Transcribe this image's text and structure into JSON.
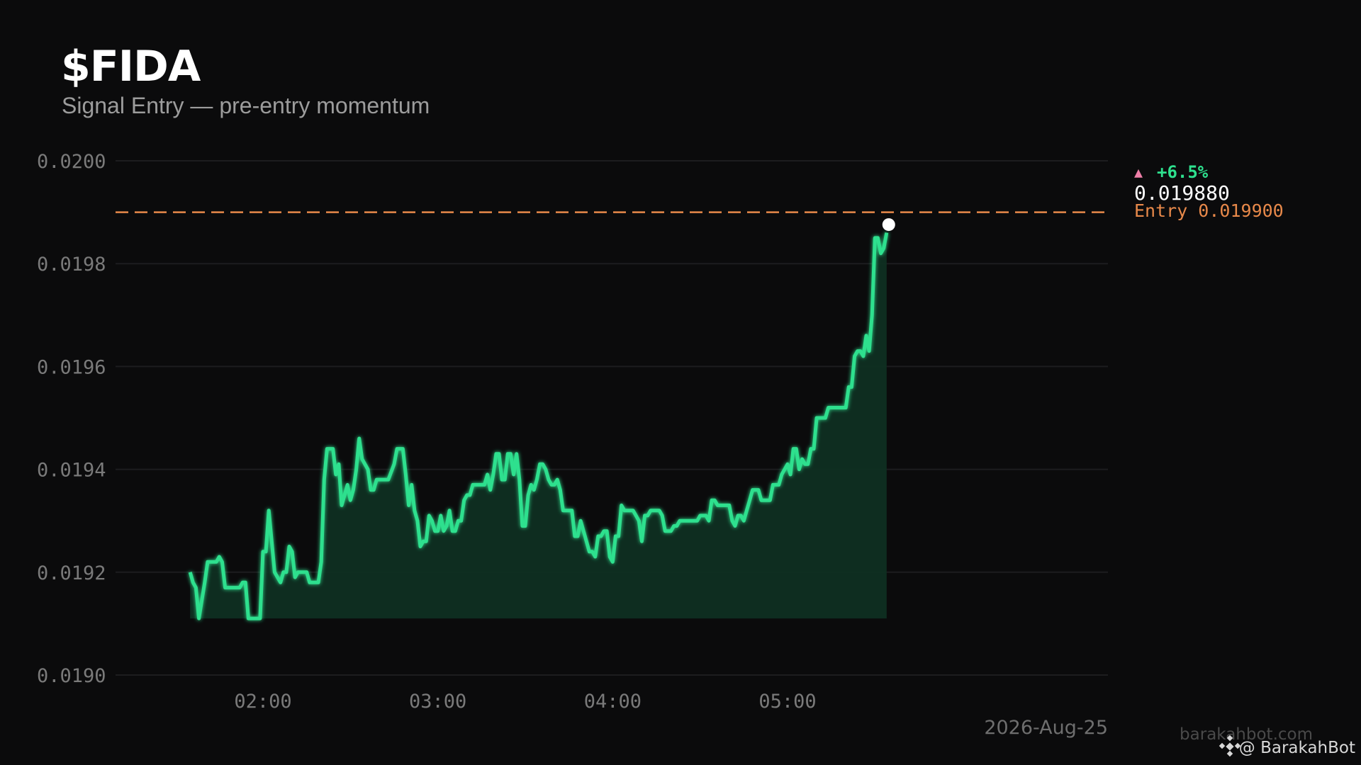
{
  "header": {
    "title": "$FIDA",
    "subtitle": "Signal Entry — pre-entry momentum"
  },
  "colors": {
    "background": "#0b0b0c",
    "line": "#2ee08e",
    "fill": "#0f2f22",
    "entry": "#e8894a",
    "change_up": "#ef7fa8",
    "change_pct": "#2ee08e",
    "axis_text": "#7a7a7a",
    "grid": "#1d1d1f"
  },
  "chart_data": {
    "type": "area",
    "title": "$FIDA",
    "subtitle": "Signal Entry — pre-entry momentum",
    "date_label": "2026-Aug-25",
    "x_range": [
      "01:35",
      "05:35"
    ],
    "ylim": [
      0.019,
      0.0201
    ],
    "y_ticks": [
      "0.0190",
      "0.0192",
      "0.0194",
      "0.0196",
      "0.0198",
      "0.0200"
    ],
    "x_ticks": [
      {
        "time": "02:00",
        "label": "02:00"
      },
      {
        "time": "03:00",
        "label": "03:00"
      },
      {
        "time": "04:00",
        "label": "04:00"
      },
      {
        "time": "05:00",
        "label": "05:00"
      }
    ],
    "grid": true,
    "entry_price": 0.0199,
    "entry_label": "Entry 0.019900",
    "last_price": 0.01988,
    "last_price_label": "0.019880",
    "change_arrow": "▲",
    "change_label": "+6.5%",
    "series": [
      {
        "name": "",
        "points": [
          [
            "01:35",
            0.0192
          ],
          [
            "01:36",
            0.01918
          ],
          [
            "01:37",
            0.01917
          ],
          [
            "01:38",
            0.01911
          ],
          [
            "01:40",
            0.01918
          ],
          [
            "01:41",
            0.01922
          ],
          [
            "01:43",
            0.01922
          ],
          [
            "01:44",
            0.01922
          ],
          [
            "01:45",
            0.01923
          ],
          [
            "01:46",
            0.01922
          ],
          [
            "01:47",
            0.01917
          ],
          [
            "01:49",
            0.01917
          ],
          [
            "01:51",
            0.01917
          ],
          [
            "01:52",
            0.01917
          ],
          [
            "01:53",
            0.01918
          ],
          [
            "01:54",
            0.01918
          ],
          [
            "01:55",
            0.01911
          ],
          [
            "01:57",
            0.01911
          ],
          [
            "01:59",
            0.01911
          ],
          [
            "02:00",
            0.01924
          ],
          [
            "02:01",
            0.01924
          ],
          [
            "02:02",
            0.01932
          ],
          [
            "02:04",
            0.0192
          ],
          [
            "02:06",
            0.01918
          ],
          [
            "02:07",
            0.0192
          ],
          [
            "02:08",
            0.0192
          ],
          [
            "02:09",
            0.01925
          ],
          [
            "02:10",
            0.01924
          ],
          [
            "02:11",
            0.01919
          ],
          [
            "02:12",
            0.0192
          ],
          [
            "02:14",
            0.0192
          ],
          [
            "02:15",
            0.0192
          ],
          [
            "02:16",
            0.01918
          ],
          [
            "02:18",
            0.01918
          ],
          [
            "02:19",
            0.01918
          ],
          [
            "02:20",
            0.01922
          ],
          [
            "02:21",
            0.01938
          ],
          [
            "02:22",
            0.01944
          ],
          [
            "02:24",
            0.01944
          ],
          [
            "02:25",
            0.01939
          ],
          [
            "02:26",
            0.01941
          ],
          [
            "02:27",
            0.01933
          ],
          [
            "02:28",
            0.01935
          ],
          [
            "02:29",
            0.01937
          ],
          [
            "02:30",
            0.01934
          ],
          [
            "02:31",
            0.01936
          ],
          [
            "02:32",
            0.0194
          ],
          [
            "02:33",
            0.01946
          ],
          [
            "02:34",
            0.01942
          ],
          [
            "02:36",
            0.0194
          ],
          [
            "02:37",
            0.01936
          ],
          [
            "02:38",
            0.01936
          ],
          [
            "02:39",
            0.01938
          ],
          [
            "02:41",
            0.01938
          ],
          [
            "02:42",
            0.01938
          ],
          [
            "02:43",
            0.01938
          ],
          [
            "02:45",
            0.01941
          ],
          [
            "02:46",
            0.01944
          ],
          [
            "02:48",
            0.01944
          ],
          [
            "02:49",
            0.01939
          ],
          [
            "02:50",
            0.01933
          ],
          [
            "02:51",
            0.01937
          ],
          [
            "02:52",
            0.01932
          ],
          [
            "02:53",
            0.0193
          ],
          [
            "02:54",
            0.01925
          ],
          [
            "02:55",
            0.01926
          ],
          [
            "02:56",
            0.01926
          ],
          [
            "02:57",
            0.01931
          ],
          [
            "02:58",
            0.0193
          ],
          [
            "02:59",
            0.01928
          ],
          [
            "03:00",
            0.01928
          ],
          [
            "03:01",
            0.01931
          ],
          [
            "03:02",
            0.01928
          ],
          [
            "03:03",
            0.01929
          ],
          [
            "03:04",
            0.01932
          ],
          [
            "03:05",
            0.01928
          ],
          [
            "03:06",
            0.01928
          ],
          [
            "03:07",
            0.0193
          ],
          [
            "03:08",
            0.0193
          ],
          [
            "03:09",
            0.01934
          ],
          [
            "03:10",
            0.01935
          ],
          [
            "03:11",
            0.01935
          ],
          [
            "03:12",
            0.01937
          ],
          [
            "03:14",
            0.01937
          ],
          [
            "03:15",
            0.01937
          ],
          [
            "03:16",
            0.01937
          ],
          [
            "03:17",
            0.01939
          ],
          [
            "03:18",
            0.01936
          ],
          [
            "03:19",
            0.01939
          ],
          [
            "03:20",
            0.01943
          ],
          [
            "03:21",
            0.01943
          ],
          [
            "03:22",
            0.01938
          ],
          [
            "03:23",
            0.01938
          ],
          [
            "03:24",
            0.01943
          ],
          [
            "03:25",
            0.01943
          ],
          [
            "03:26",
            0.01939
          ],
          [
            "03:27",
            0.01943
          ],
          [
            "03:28",
            0.01938
          ],
          [
            "03:29",
            0.01929
          ],
          [
            "03:30",
            0.01929
          ],
          [
            "03:31",
            0.01935
          ],
          [
            "03:32",
            0.01937
          ],
          [
            "03:33",
            0.01936
          ],
          [
            "03:34",
            0.01938
          ],
          [
            "03:35",
            0.01941
          ],
          [
            "03:36",
            0.01941
          ],
          [
            "03:37",
            0.0194
          ],
          [
            "03:38",
            0.01938
          ],
          [
            "03:39",
            0.01937
          ],
          [
            "03:40",
            0.01937
          ],
          [
            "03:41",
            0.01938
          ],
          [
            "03:42",
            0.01936
          ],
          [
            "03:43",
            0.01932
          ],
          [
            "03:44",
            0.01932
          ],
          [
            "03:45",
            0.01932
          ],
          [
            "03:46",
            0.01932
          ],
          [
            "03:47",
            0.01927
          ],
          [
            "03:48",
            0.01927
          ],
          [
            "03:49",
            0.0193
          ],
          [
            "03:50",
            0.01928
          ],
          [
            "03:51",
            0.01926
          ],
          [
            "03:52",
            0.01924
          ],
          [
            "03:53",
            0.01924
          ],
          [
            "03:54",
            0.01923
          ],
          [
            "03:55",
            0.01927
          ],
          [
            "03:56",
            0.01927
          ],
          [
            "03:57",
            0.01928
          ],
          [
            "03:58",
            0.01928
          ],
          [
            "03:59",
            0.01923
          ],
          [
            "04:00",
            0.01922
          ],
          [
            "04:01",
            0.01927
          ],
          [
            "04:02",
            0.01927
          ],
          [
            "04:03",
            0.01933
          ],
          [
            "04:04",
            0.01932
          ],
          [
            "04:05",
            0.01932
          ],
          [
            "04:06",
            0.01932
          ],
          [
            "04:07",
            0.01932
          ],
          [
            "04:08",
            0.01931
          ],
          [
            "04:09",
            0.0193
          ],
          [
            "04:10",
            0.01926
          ],
          [
            "04:11",
            0.01931
          ],
          [
            "04:12",
            0.01931
          ],
          [
            "04:13",
            0.01932
          ],
          [
            "04:14",
            0.01932
          ],
          [
            "04:15",
            0.01932
          ],
          [
            "04:16",
            0.01932
          ],
          [
            "04:17",
            0.01931
          ],
          [
            "04:18",
            0.01928
          ],
          [
            "04:19",
            0.01928
          ],
          [
            "04:20",
            0.01928
          ],
          [
            "04:21",
            0.01929
          ],
          [
            "04:22",
            0.01929
          ],
          [
            "04:23",
            0.0193
          ],
          [
            "04:24",
            0.0193
          ],
          [
            "04:25",
            0.0193
          ],
          [
            "04:26",
            0.0193
          ],
          [
            "04:27",
            0.0193
          ],
          [
            "04:28",
            0.0193
          ],
          [
            "04:29",
            0.0193
          ],
          [
            "04:30",
            0.01931
          ],
          [
            "04:31",
            0.01931
          ],
          [
            "04:32",
            0.01931
          ],
          [
            "04:33",
            0.0193
          ],
          [
            "04:34",
            0.01934
          ],
          [
            "04:35",
            0.01934
          ],
          [
            "04:36",
            0.01933
          ],
          [
            "04:37",
            0.01933
          ],
          [
            "04:38",
            0.01933
          ],
          [
            "04:39",
            0.01933
          ],
          [
            "04:40",
            0.01933
          ],
          [
            "04:41",
            0.0193
          ],
          [
            "04:42",
            0.01929
          ],
          [
            "04:43",
            0.01931
          ],
          [
            "04:44",
            0.01931
          ],
          [
            "04:45",
            0.0193
          ],
          [
            "04:46",
            0.01932
          ],
          [
            "04:47",
            0.01934
          ],
          [
            "04:48",
            0.01936
          ],
          [
            "04:49",
            0.01936
          ],
          [
            "04:50",
            0.01936
          ],
          [
            "04:51",
            0.01934
          ],
          [
            "04:52",
            0.01934
          ],
          [
            "04:53",
            0.01934
          ],
          [
            "04:54",
            0.01934
          ],
          [
            "04:55",
            0.01937
          ],
          [
            "04:56",
            0.01937
          ],
          [
            "04:57",
            0.01937
          ],
          [
            "04:58",
            0.01939
          ],
          [
            "04:59",
            0.0194
          ],
          [
            "05:00",
            0.01941
          ],
          [
            "05:01",
            0.01939
          ],
          [
            "05:02",
            0.01944
          ],
          [
            "05:03",
            0.01944
          ],
          [
            "05:04",
            0.0194
          ],
          [
            "05:05",
            0.01942
          ],
          [
            "05:06",
            0.01941
          ],
          [
            "05:07",
            0.01941
          ],
          [
            "05:08",
            0.01944
          ],
          [
            "05:09",
            0.01944
          ],
          [
            "05:10",
            0.0195
          ],
          [
            "05:11",
            0.0195
          ],
          [
            "05:12",
            0.0195
          ],
          [
            "05:13",
            0.0195
          ],
          [
            "05:14",
            0.01952
          ],
          [
            "05:15",
            0.01952
          ],
          [
            "05:16",
            0.01952
          ],
          [
            "05:17",
            0.01952
          ],
          [
            "05:18",
            0.01952
          ],
          [
            "05:19",
            0.01952
          ],
          [
            "05:20",
            0.01952
          ],
          [
            "05:21",
            0.01956
          ],
          [
            "05:22",
            0.01956
          ],
          [
            "05:23",
            0.01962
          ],
          [
            "05:24",
            0.01963
          ],
          [
            "05:25",
            0.01963
          ],
          [
            "05:26",
            0.01962
          ],
          [
            "05:27",
            0.01966
          ],
          [
            "05:28",
            0.01963
          ],
          [
            "05:29",
            0.0197
          ],
          [
            "05:30",
            0.01985
          ],
          [
            "05:31",
            0.01985
          ],
          [
            "05:32",
            0.01982
          ],
          [
            "05:33",
            0.01983
          ],
          [
            "05:34",
            0.01986
          ]
        ]
      }
    ],
    "area_baseline": 0.01911
  },
  "watermark": {
    "site": "barakahbot.com",
    "handle": "@ BarakahBot",
    "icon": "binance-diamond-icon"
  }
}
